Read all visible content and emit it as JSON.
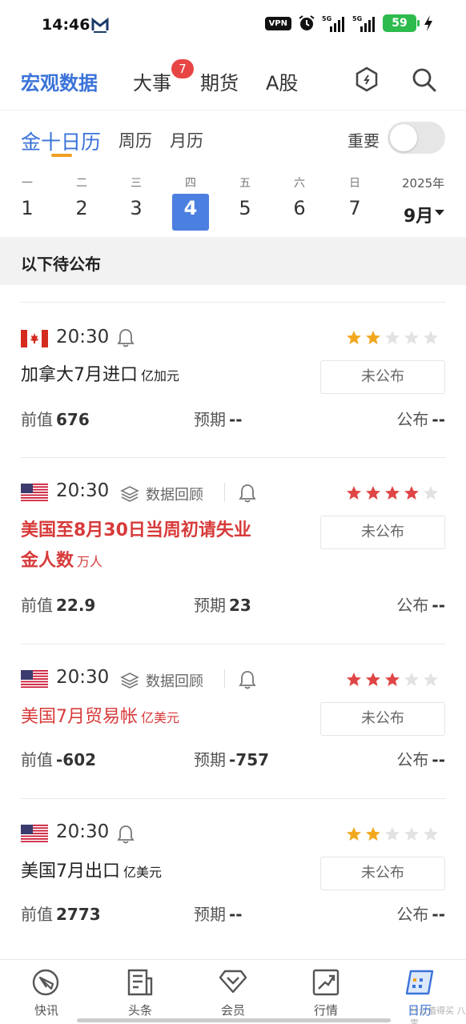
{
  "status_bar": {
    "time": "14:46",
    "vpn": "VPN",
    "net1": "5G",
    "net2": "5G",
    "battery": "59"
  },
  "top_nav": {
    "tabs": [
      {
        "label": "宏观数据",
        "active": true
      },
      {
        "label": "大事",
        "badge": "7"
      },
      {
        "label": "期货"
      },
      {
        "label": "A股"
      }
    ],
    "icons": [
      "hexagon-icon",
      "search-icon"
    ]
  },
  "sub_tabs": {
    "items": [
      "金十日历",
      "周历",
      "月历"
    ],
    "important_label": "重要"
  },
  "week": {
    "days": [
      {
        "wd": "一",
        "dn": "1"
      },
      {
        "wd": "二",
        "dn": "2"
      },
      {
        "wd": "三",
        "dn": "3"
      },
      {
        "wd": "四",
        "dn": "4",
        "selected": true
      },
      {
        "wd": "五",
        "dn": "5"
      },
      {
        "wd": "六",
        "dn": "6"
      },
      {
        "wd": "日",
        "dn": "7"
      }
    ],
    "year": "2025年",
    "month": "9月"
  },
  "pending_label": "以下待公布",
  "events": [
    {
      "country": "canada",
      "time": "20:30",
      "review": "",
      "stars": 2,
      "star_color": "#f2a81e",
      "title": "加拿大7月进口",
      "unit": "亿加元",
      "status": "未公布",
      "prev_label": "前值",
      "prev": "676",
      "exp_label": "预期",
      "exp": "--",
      "pub_label": "公布",
      "pub": "--"
    },
    {
      "country": "usa",
      "time": "20:30",
      "review": "数据回顾",
      "stars": 4,
      "star_color": "#e04545",
      "title_line1": "美国至8月30日当周初请失业",
      "title_line2": "金人数",
      "unit": "万人",
      "status": "未公布",
      "prev_label": "前值",
      "prev": "22.9",
      "exp_label": "预期",
      "exp": "23",
      "pub_label": "公布",
      "pub": "--"
    },
    {
      "country": "usa",
      "time": "20:30",
      "review": "数据回顾",
      "stars": 3,
      "star_color": "#e04545",
      "title": "美国7月贸易帐",
      "unit": "亿美元",
      "status": "未公布",
      "prev_label": "前值",
      "prev": "-602",
      "exp_label": "预期",
      "exp": "-757",
      "pub_label": "公布",
      "pub": "--"
    },
    {
      "country": "usa",
      "time": "20:30",
      "review": "",
      "stars": 2,
      "star_color": "#f2a81e",
      "title": "美国7月出口",
      "unit": "亿美元",
      "status": "未公布",
      "prev_label": "前值",
      "prev": "2773",
      "exp_label": "预期",
      "exp": "--",
      "pub_label": "公布",
      "pub": "--"
    }
  ],
  "bottom_nav": [
    {
      "label": "快讯",
      "icon": "flash-news-icon"
    },
    {
      "label": "头条",
      "icon": "headline-icon"
    },
    {
      "label": "会员",
      "icon": "vip-icon"
    },
    {
      "label": "行情",
      "icon": "market-icon"
    },
    {
      "label": "日历",
      "icon": "calendar-icon",
      "active": true
    }
  ],
  "watermark": "什么值得买 八零"
}
